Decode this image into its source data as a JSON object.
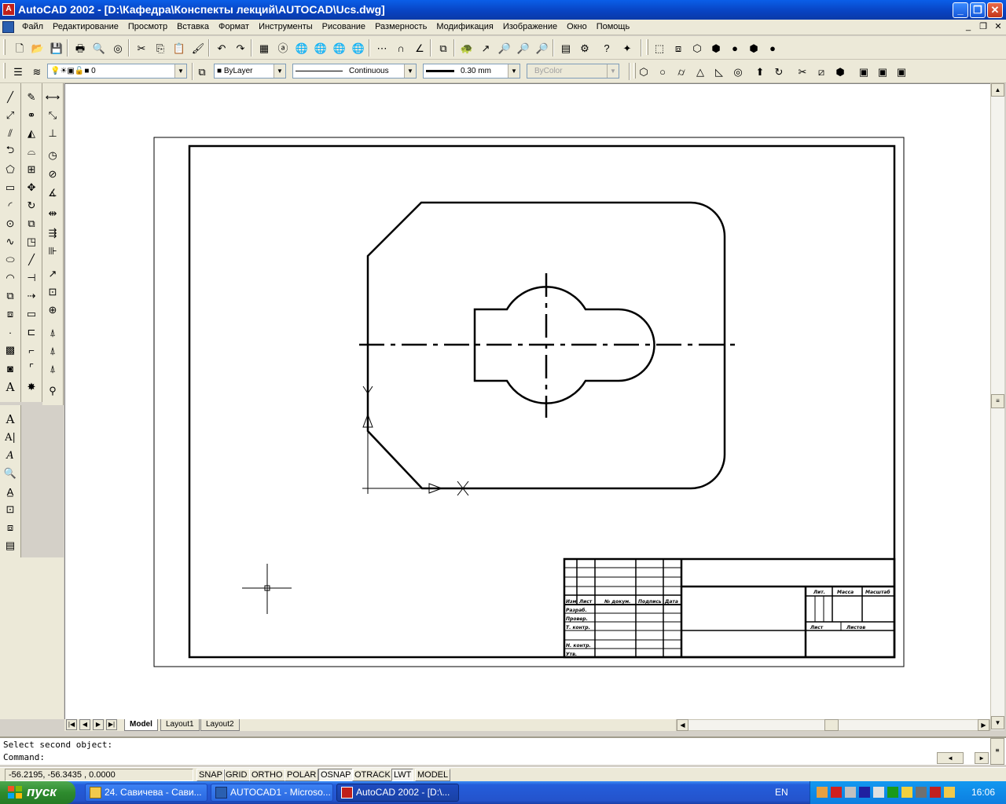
{
  "window": {
    "title": "AutoCAD 2002 - [D:\\Кафедра\\Конспекты лекций\\AUTOCAD\\Ucs.dwg]",
    "app_icon": "autocad-icon",
    "controls": [
      "_",
      "❐",
      "✕"
    ]
  },
  "menu": {
    "items": [
      "Файл",
      "Редактирование",
      "Просмотр",
      "Вставка",
      "Формат",
      "Инструменты",
      "Рисование",
      "Размерность",
      "Модификация",
      "Изображение",
      "Окно",
      "Помощь"
    ],
    "mdi_controls": [
      "_",
      "❐",
      "✕"
    ]
  },
  "properties": {
    "layer": "0",
    "color": "ByLayer",
    "linetype": "Continuous",
    "lineweight": "0.30 mm",
    "plotstyle": "ByColor"
  },
  "tabs": {
    "nav": [
      "|◀",
      "◀",
      "▶",
      "▶|"
    ],
    "items": [
      "Model",
      "Layout1",
      "Layout2"
    ],
    "active": "Model"
  },
  "drawing": {
    "ucs_x_label": "X",
    "ucs_y_label": "Y",
    "title_block": {
      "row_labels": [
        "Изм",
        "Лист",
        "№ докум.",
        "Подпись",
        "Дата",
        "Разраб.",
        "Провер.",
        "Т. контр.",
        "Н. контр.",
        "Утв."
      ],
      "right_headers": [
        "Лит.",
        "Масса",
        "Масштаб",
        "Лист",
        "Листов"
      ]
    }
  },
  "command": {
    "line1": "Select second object:",
    "line2": "Command:"
  },
  "status": {
    "coords": "-56.2195, -56.3435 , 0.0000",
    "toggles": [
      {
        "label": "SNAP",
        "on": false
      },
      {
        "label": "GRID",
        "on": false
      },
      {
        "label": "ORTHO",
        "on": false
      },
      {
        "label": "POLAR",
        "on": false
      },
      {
        "label": "OSNAP",
        "on": true
      },
      {
        "label": "OTRACK",
        "on": false
      },
      {
        "label": "LWT",
        "on": true
      },
      {
        "label": "MODEL",
        "on": false
      }
    ]
  },
  "taskbar": {
    "start": "пуск",
    "tasks": [
      "24. Савичева - Сави...",
      "AUTOCAD1 - Microso...",
      "AutoCAD 2002 - [D:\\..."
    ],
    "active_task": 2,
    "lang": "EN",
    "clock": "16:06"
  }
}
